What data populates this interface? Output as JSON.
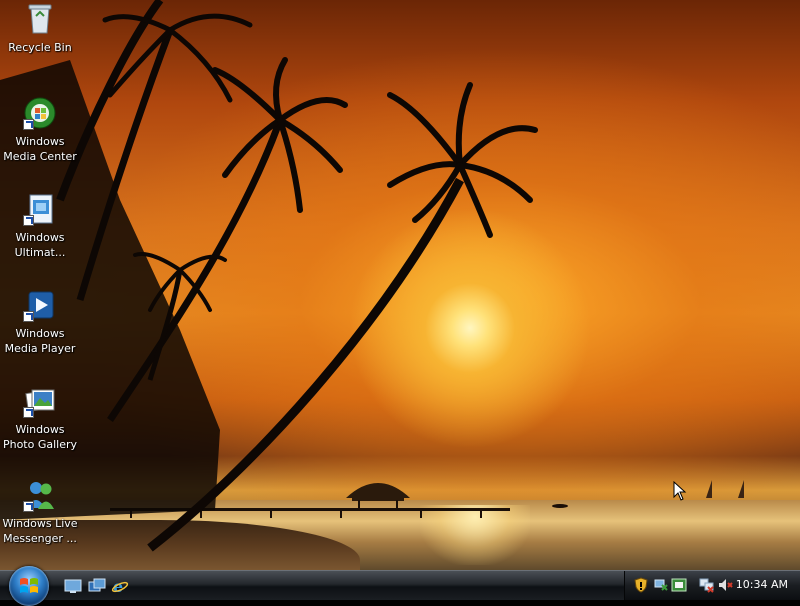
{
  "desktop": {
    "icons": [
      {
        "label": "Recycle Bin",
        "icon": "recycle-bin-icon"
      },
      {
        "label": "Windows Media Center",
        "icon": "media-center-icon"
      },
      {
        "label": "Windows Ultimat...",
        "icon": "windows-ultimate-extras-icon"
      },
      {
        "label": "Windows Media Player",
        "icon": "media-player-icon"
      },
      {
        "label": "Windows Photo Gallery",
        "icon": "photo-gallery-icon"
      },
      {
        "label": "Windows Live Messenger ...",
        "icon": "live-messenger-icon"
      }
    ]
  },
  "taskbar": {
    "start": {
      "icon": "windows-start-orb-icon"
    },
    "quick_launch": [
      {
        "icon": "show-desktop-icon"
      },
      {
        "icon": "switch-windows-icon"
      },
      {
        "icon": "internet-explorer-icon"
      }
    ],
    "tray": {
      "icons": [
        "security-shield-icon",
        "network-icon",
        "windows-update-icon",
        "network-disconnected-icon",
        "volume-muted-icon"
      ],
      "clock": "10:34 AM"
    }
  },
  "colors": {
    "sky_dark": "#6b2606",
    "sky_mid": "#d8731c",
    "sun": "#ffe27a",
    "taskbar": "#0d1014",
    "accent_blue": "#2f7fc9"
  }
}
